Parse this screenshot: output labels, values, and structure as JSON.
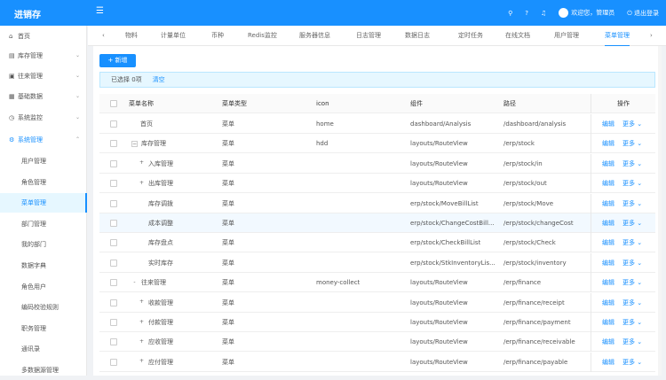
{
  "header": {
    "logo": "进销存",
    "user": "欢迎您，管理员",
    "logout": "退出登录"
  },
  "sidebar": {
    "items": [
      {
        "label": "首页",
        "icon": "home-icon",
        "chev": ""
      },
      {
        "label": "库存管理",
        "icon": "stock-icon",
        "chev": "⌄"
      },
      {
        "label": "往来管理",
        "icon": "finance-icon",
        "chev": "⌄"
      },
      {
        "label": "基础数据",
        "icon": "data-icon",
        "chev": "⌄"
      },
      {
        "label": "系统监控",
        "icon": "monitor-icon",
        "chev": "⌄"
      },
      {
        "label": "系统管理",
        "icon": "settings-icon",
        "chev": "⌃"
      }
    ],
    "sub": [
      "用户管理",
      "角色管理",
      "菜单管理",
      "部门管理",
      "我的部门",
      "数据字典",
      "角色用户",
      "编码校验规则",
      "职务管理",
      "通讯录",
      "多数据源管理"
    ]
  },
  "tabs": [
    "物料",
    "计量单位",
    "币种",
    "Redis监控",
    "服务器信息",
    "日志管理",
    "数据日志",
    "定时任务",
    "在线文档",
    "用户管理",
    "菜单管理"
  ],
  "toolbar": {
    "add": "+ 新增",
    "selected": "已选择 0项",
    "clear": "清空"
  },
  "table": {
    "columns": [
      "菜单名称",
      "菜单类型",
      "icon",
      "组件",
      "路径",
      "操作"
    ],
    "edit": "编辑",
    "more": "更多 ⌄",
    "rows": [
      {
        "name": "首页",
        "exp": "",
        "lvl": 0,
        "type": "菜单",
        "icon": "home",
        "comp": "dashboard/Analysis",
        "path": "/dashboard/analysis"
      },
      {
        "name": "库存管理",
        "exp": "−",
        "lvl": 0,
        "type": "菜单",
        "icon": "hdd",
        "comp": "layouts/RouteView",
        "path": "/erp/stock"
      },
      {
        "name": "入库管理",
        "exp": "+",
        "lvl": 1,
        "type": "菜单",
        "icon": "",
        "comp": "layouts/RouteView",
        "path": "/erp/stock/in"
      },
      {
        "name": "出库管理",
        "exp": "+",
        "lvl": 1,
        "type": "菜单",
        "icon": "",
        "comp": "layouts/RouteView",
        "path": "/erp/stock/out"
      },
      {
        "name": "库存调拨",
        "exp": "",
        "lvl": 2,
        "type": "菜单",
        "icon": "",
        "comp": "erp/stock/MoveBillList",
        "path": "/erp/stock/Move"
      },
      {
        "name": "成本调整",
        "exp": "",
        "lvl": 2,
        "type": "菜单",
        "icon": "",
        "comp": "erp/stock/ChangeCostBill...",
        "path": "/erp/stock/changeCost"
      },
      {
        "name": "库存盘点",
        "exp": "",
        "lvl": 2,
        "type": "菜单",
        "icon": "",
        "comp": "erp/stock/CheckBillList",
        "path": "/erp/stock/Check"
      },
      {
        "name": "实时库存",
        "exp": "",
        "lvl": 2,
        "type": "菜单",
        "icon": "",
        "comp": "erp/stock/StkInventoryLis...",
        "path": "/erp/stock/inventory"
      },
      {
        "name": "往来管理",
        "exp": "-",
        "lvl": 0,
        "type": "菜单",
        "icon": "money-collect",
        "comp": "layouts/RouteView",
        "path": "/erp/finance"
      },
      {
        "name": "收款管理",
        "exp": "+",
        "lvl": 1,
        "type": "菜单",
        "icon": "",
        "comp": "layouts/RouteView",
        "path": "/erp/finance/receipt"
      },
      {
        "name": "付款管理",
        "exp": "+",
        "lvl": 1,
        "type": "菜单",
        "icon": "",
        "comp": "layouts/RouteView",
        "path": "/erp/finance/payment"
      },
      {
        "name": "应收管理",
        "exp": "+",
        "lvl": 1,
        "type": "菜单",
        "icon": "",
        "comp": "layouts/RouteView",
        "path": "/erp/finance/receivable"
      },
      {
        "name": "应付管理",
        "exp": "+",
        "lvl": 1,
        "type": "菜单",
        "icon": "",
        "comp": "layouts/RouteView",
        "path": "/erp/finance/payable"
      }
    ]
  }
}
